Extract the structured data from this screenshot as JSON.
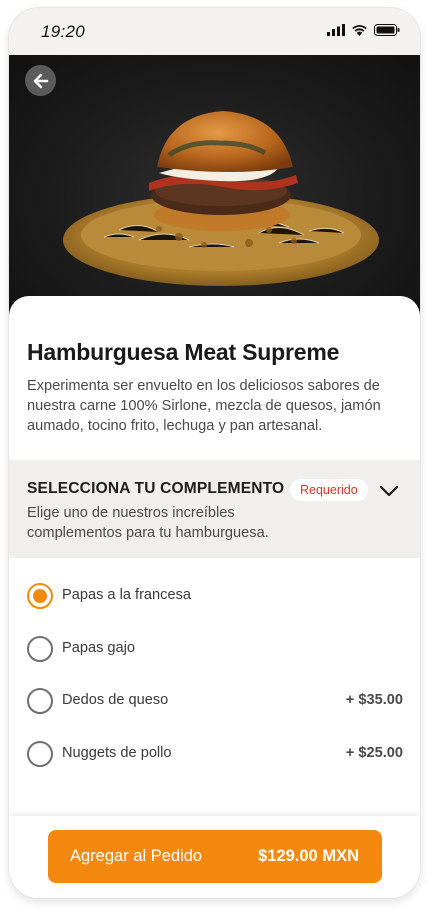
{
  "status_bar": {
    "time": "19:20"
  },
  "product": {
    "title": "Hamburguesa Meat Supreme",
    "description": "Experimenta ser envuelto en los deliciosos sabores de nuestra carne 100% Sirlone, mezcla de quesos, jamón aumado, tocino frito, lechuga y pan artesanal."
  },
  "complement_section": {
    "title": "SELECCIONA TU COMPLEMENTO",
    "required_badge": "Requerido",
    "subtitle": "Elige uno de nuestros increíbles complementos para tu hamburguesa.",
    "options": [
      {
        "label": "Papas a la francesa",
        "price": "",
        "selected": true
      },
      {
        "label": "Papas gajo",
        "price": "",
        "selected": false
      },
      {
        "label": "Dedos de queso",
        "price": "+ $35.00",
        "selected": false
      },
      {
        "label": "Nuggets de pollo",
        "price": "+ $25.00",
        "selected": false
      }
    ]
  },
  "footer": {
    "button_label": "Agregar al Pedido",
    "button_price": "$129.00 MXN"
  },
  "colors": {
    "accent": "#f5890f",
    "required": "#d9342b",
    "section_bg": "#f1efed"
  }
}
